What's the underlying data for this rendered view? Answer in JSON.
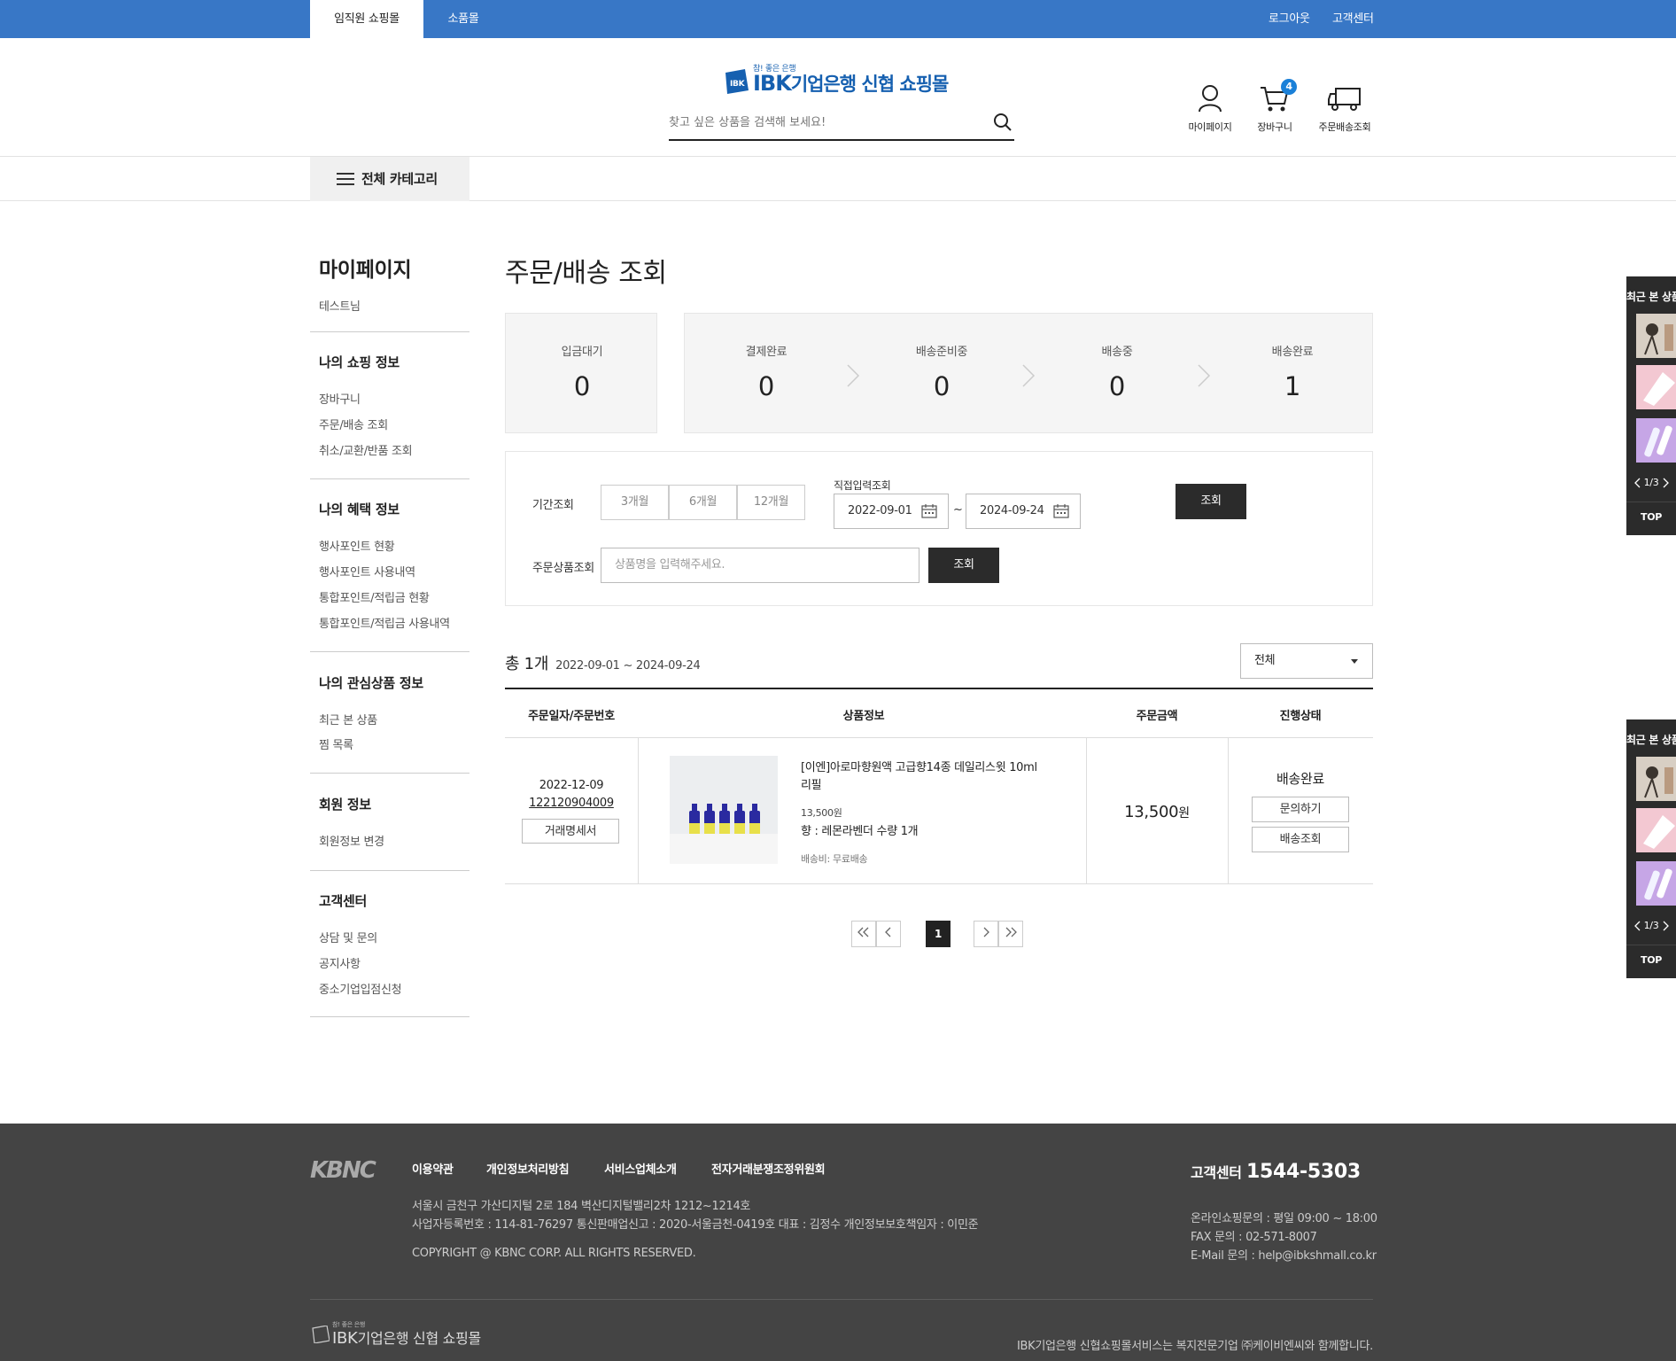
{
  "topbar": {
    "tabs": [
      "임직원 쇼핑몰",
      "소품몰"
    ],
    "logout": "로그아웃",
    "customer_center": "고객센터"
  },
  "header": {
    "logo_tagline": "참! 좋은 은행",
    "logo_brand": "IBK",
    "logo_rest": "기업은행 신협 쇼핑몰",
    "search_placeholder": "찾고 싶은 상품을 검색해 보세요!",
    "icons": [
      {
        "label": "마이페이지",
        "icon": "user-icon"
      },
      {
        "label": "장바구니",
        "icon": "cart-icon",
        "badge": "4"
      },
      {
        "label": "주문배송조회",
        "icon": "truck-icon"
      }
    ]
  },
  "nav": {
    "all_category": "전체 카테고리"
  },
  "sidebar": {
    "title": "마이페이지",
    "user": "테스트님",
    "groups": [
      {
        "heading": "나의 쇼핑 정보",
        "items": [
          "장바구니",
          "주문/배송 조회",
          "취소/교환/반품 조회"
        ]
      },
      {
        "heading": "나의 혜택 정보",
        "items": [
          "행사포인트 현황",
          "행사포인트 사용내역",
          "통합포인트/적립금 현황",
          "통합포인트/적립금 사용내역"
        ]
      },
      {
        "heading": "나의 관심상품 정보",
        "items": [
          "최근 본 상품",
          "찜 목록"
        ]
      },
      {
        "heading": "회원 정보",
        "items": [
          "회원정보 변경"
        ]
      },
      {
        "heading": "고객센터",
        "items": [
          "상담 및 문의",
          "공지사항",
          "중소기업입점신청"
        ]
      }
    ]
  },
  "main": {
    "title": "주문/배송 조회",
    "stats": [
      {
        "label": "입금대기",
        "value": "0"
      },
      {
        "label": "결제완료",
        "value": "0"
      },
      {
        "label": "배송준비중",
        "value": "0"
      },
      {
        "label": "배송중",
        "value": "0"
      },
      {
        "label": "배송완료",
        "value": "1"
      }
    ],
    "filter": {
      "period_label": "기간조회",
      "periods": [
        "3개월",
        "6개월",
        "12개월"
      ],
      "direct_label": "직접입력조회",
      "date_from": "2022-09-01",
      "date_to": "2024-09-24",
      "tilde": "~",
      "search_btn": "조회",
      "product_label": "주문상품조회",
      "product_placeholder": "상품명을 입력해주세요.",
      "product_btn": "조회"
    },
    "total_label": "총 1개",
    "total_range": "2022-09-01 ~ 2024-09-24",
    "status_select": "전체",
    "table": {
      "headers": [
        "주문일자/주문번호",
        "상품정보",
        "주문금액",
        "진행상태"
      ],
      "rows": [
        {
          "date": "2022-12-09",
          "order_no": "122120904009",
          "receipt_btn": "거래명세서",
          "product_name_1": "[이엔]아로마향원액 고급향14종 데일리스윗 10ml",
          "product_name_2": "리필",
          "unit_price": "13,500원",
          "option": "향 : 레몬라벤더 수량 1개",
          "shipping": "배송비: 무료배송",
          "amount": "13,500",
          "amount_unit": "원",
          "status": "배송완료",
          "inquiry_btn": "문의하기",
          "track_btn": "배송조회"
        }
      ]
    },
    "pagination": {
      "current": "1"
    }
  },
  "recent_widget": {
    "title": "최근 본 상품",
    "page": "1/3",
    "top": "TOP"
  },
  "footer": {
    "logo": "KBNC",
    "links": [
      "이용약관",
      "개인정보처리방침",
      "서비스업체소개",
      "전자거래분쟁조정위원회"
    ],
    "address": "서울시 금천구 가산디지털 2로 184 벽산디지털밸리2차 1212~1214호",
    "business": "사업자등록번호 : 114-81-76297 통신판매업신고 : 2020-서울금천-0419호 대표 : 김정수 개인정보보호책임자 : 이민준",
    "copyright": "COPYRIGHT @ KBNC CORP. ALL RIGHTS RESERVED.",
    "cs_label": "고객센터",
    "cs_number": "1544-5303",
    "online_hours": "온라인쇼핑문의 : 평일 09:00 ~ 18:00",
    "fax": "FAX 문의 : 02-571-8007",
    "email": "E-Mail 문의 : help@ibkshmall.co.kr",
    "bottom_logo_tag": "참! 좋은 은행",
    "bottom_logo_brand": "IBK",
    "bottom_logo_rest": "기업은행 신협 쇼핑몰",
    "bottom_note": "IBK기업은행 신협쇼핑몰서비스는 복지전문기업 ㈜케이비엔씨와 함께합니다."
  },
  "colors": {
    "topbar": "#3877c6",
    "brand": "#1660b0",
    "dark_button": "#2b2b2b",
    "footer": "#444444",
    "badge": "#1a80d8"
  }
}
